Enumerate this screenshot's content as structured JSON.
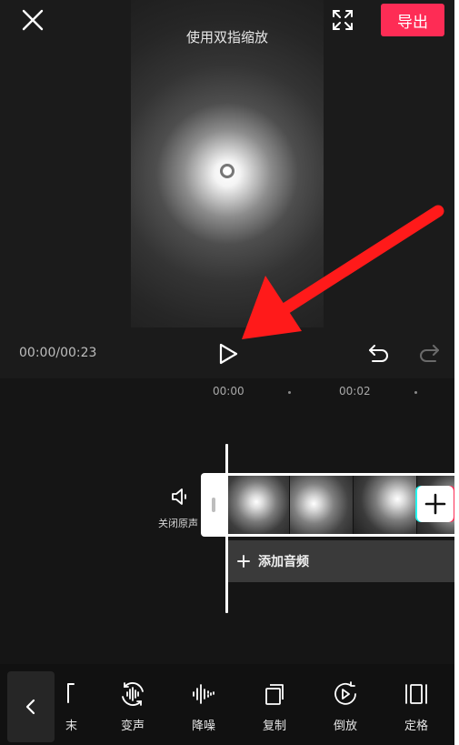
{
  "header": {
    "close_icon": "close-icon",
    "fullscreen_icon": "fullscreen-icon",
    "export_label": "导出",
    "accent_color": "#fe2c55"
  },
  "preview": {
    "hint": "使用双指缩放"
  },
  "transport": {
    "timecode": "00:00/00:23",
    "play_icon": "play-icon",
    "undo_icon": "undo-icon",
    "redo_icon": "redo-icon"
  },
  "timeline": {
    "ruler": [
      "00:00",
      "00:02"
    ],
    "mute_label": "关闭原声",
    "mute_icon": "speaker-icon",
    "add_clip_icon": "plus-icon",
    "add_audio_label": "添加音频"
  },
  "toolbar": {
    "back_icon": "chevron-left-icon",
    "partial_tool_label": "末",
    "tools": [
      {
        "label": "变声",
        "icon": "voice-change-icon"
      },
      {
        "label": "降噪",
        "icon": "noise-reduction-icon"
      },
      {
        "label": "复制",
        "icon": "copy-icon"
      },
      {
        "label": "倒放",
        "icon": "reverse-icon"
      },
      {
        "label": "定格",
        "icon": "freeze-frame-icon"
      }
    ]
  },
  "annotation": {
    "arrow_color": "#ff1a1a",
    "arrow_icon": "red-arrow-icon"
  }
}
